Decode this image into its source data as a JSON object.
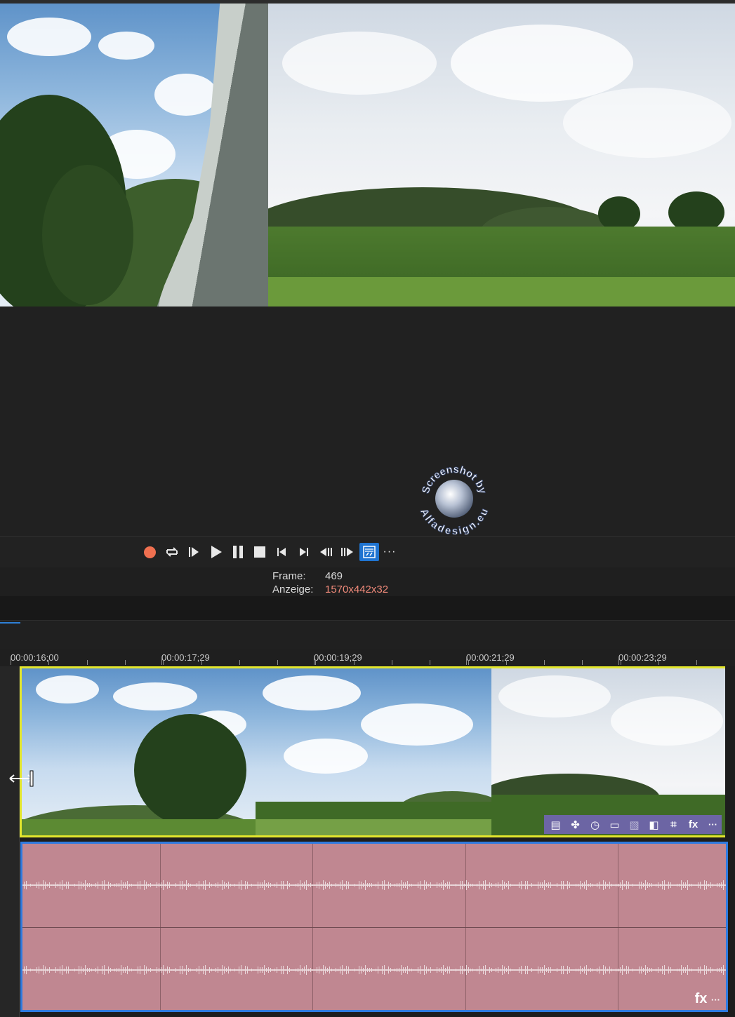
{
  "preview": {
    "description_icon": "video-preview"
  },
  "transport": {
    "buttons": [
      {
        "name": "record-button",
        "icon": "record-icon"
      },
      {
        "name": "loop-button",
        "icon": "loop-icon"
      },
      {
        "name": "play-from-start-button",
        "icon": "play-from-start-icon"
      },
      {
        "name": "play-button",
        "icon": "play-icon"
      },
      {
        "name": "pause-button",
        "icon": "pause-icon"
      },
      {
        "name": "stop-button",
        "icon": "stop-icon"
      },
      {
        "name": "go-to-start-button",
        "icon": "go-to-start-icon"
      },
      {
        "name": "go-to-end-button",
        "icon": "go-to-end-icon"
      },
      {
        "name": "previous-frame-button",
        "icon": "previous-frame-icon"
      },
      {
        "name": "next-frame-button",
        "icon": "next-frame-icon"
      },
      {
        "name": "video-preview-options-button",
        "icon": "video-options-icon",
        "active": true
      },
      {
        "name": "more-button",
        "icon": "more-icon"
      }
    ],
    "more_glyph": "···"
  },
  "info": {
    "frame_label": "Frame:",
    "frame_value": "469",
    "display_label": "Anzeige:",
    "display_value": "1570x442x32",
    "display_value_color": "#f08a7a"
  },
  "timeline": {
    "ruler_labels": [
      "00:00:16;00",
      "00:00:17;29",
      "00:00:19;29",
      "00:00:21;29",
      "00:00:23;29"
    ],
    "video_event": {
      "border_color": "#e3e62d",
      "fx_icons": [
        "event-pan-crop-fx-icon",
        "media-fx-icon",
        "event-speed-icon",
        "event-switches-icon",
        "event-properties-icon",
        "generated-media-icon",
        "crop-icon",
        "fx-icon",
        "more-icon"
      ],
      "fx_label": "fx",
      "more_glyph": "···"
    },
    "audio_event": {
      "color": "#c08791",
      "border_color": "#2f7be0",
      "fx_label": "fx",
      "more_glyph": "···"
    }
  },
  "watermark": {
    "text_top": "Screenshot by",
    "text_bottom": "Alfadesign.eu"
  },
  "colors": {
    "accent_blue": "#1f74d1",
    "record_red": "#f07050",
    "fx_bar": "#7864c8"
  }
}
